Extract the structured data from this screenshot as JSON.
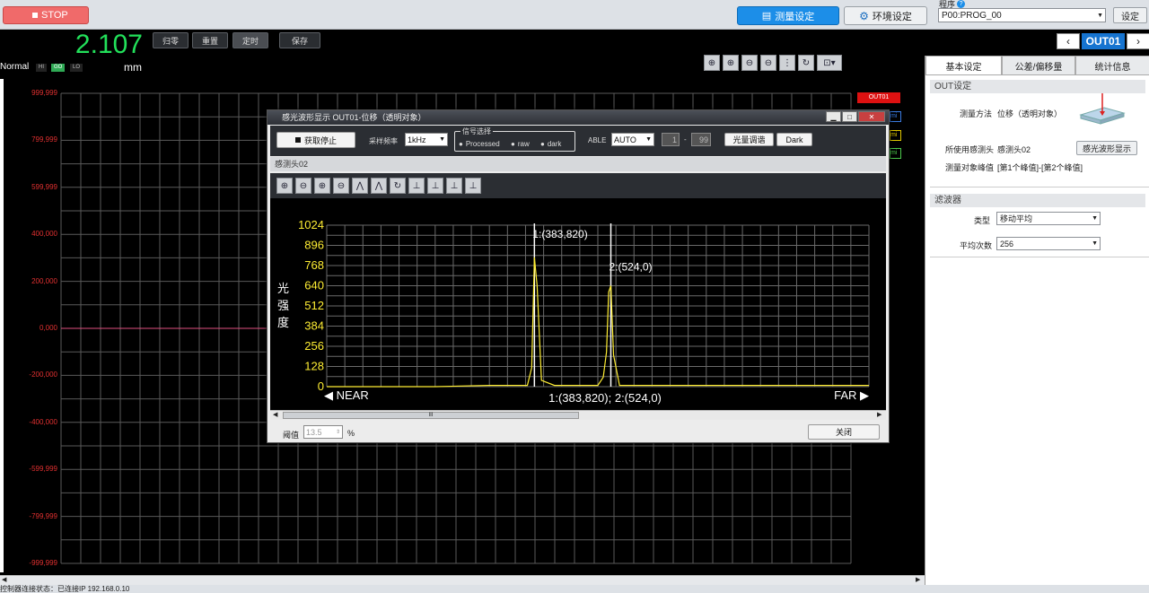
{
  "top": {
    "stop_label": "STOP",
    "measure_setting": "测量设定",
    "env_setting": "环境设定",
    "program_label": "程序",
    "program_value": "P00:PROG_00",
    "set_button": "设定"
  },
  "display": {
    "value": "2.107",
    "status": "Normal",
    "hi": "HI",
    "go": "GO",
    "lo": "LO",
    "unit": "mm",
    "buttons": [
      "归零",
      "重置",
      "定时",
      "保存"
    ]
  },
  "graph": {
    "y_ticks": [
      "999,999",
      "799,999",
      "599,999",
      "400,000",
      "200,000",
      "0,000",
      "-200,000",
      "-400,000",
      "-599,999",
      "-799,999",
      "-999,999"
    ],
    "out_badge": "OUT01"
  },
  "right": {
    "out_nav": "OUT01",
    "tabs": [
      "基本设定",
      "公差/偏移量",
      "统计信息"
    ],
    "out_section": "OUT设定",
    "method_label": "测量方法",
    "method_value": "位移（透明对象）",
    "head_label": "所使用感测头",
    "head_value": "感测头02",
    "wave_button": "感光波形显示",
    "target_label": "测量对象峰值",
    "target_value": "[第1个峰值]-[第2个峰值]",
    "filter_section": "滤波器",
    "type_label": "类型",
    "type_value": "移动平均",
    "avg_label": "平均次数",
    "avg_value": "256"
  },
  "status_bar": "控制器连接状态：已连接IP 192.168.0.10",
  "dialog": {
    "title": "感光波形显示 OUT01-位移（透明对象）",
    "stop_capture": "获取停止",
    "sampling_label": "采样频率",
    "sampling_value": "1kHz",
    "signal_group": "信号选择",
    "radio_processed": "Processed",
    "radio_raw": "raw",
    "radio_dark": "dark",
    "able_label": "ABLE",
    "able_value": "AUTO",
    "range_from": "1",
    "range_sep": "-",
    "range_to": "99",
    "light_adjust": "光量调谐",
    "dark_button": "Dark",
    "head_tab": "感测头02",
    "threshold_label": "阈值",
    "threshold_value": "13.5",
    "threshold_unit": "%",
    "close_button": "关闭",
    "scroll_mark": "III"
  },
  "chart_data": {
    "type": "line",
    "ylabel": "光强度",
    "ylim": [
      0,
      1024
    ],
    "y_ticks": [
      0,
      128,
      256,
      384,
      512,
      640,
      768,
      896,
      1024
    ],
    "near_label": "NEAR",
    "far_label": "FAR",
    "peak1_label": "1:(383,820)",
    "peak2_label": "2:(524,0)",
    "footer_label": "1:(383,820); 2:(524,0)",
    "x": [
      0,
      200,
      300,
      340,
      370,
      378,
      383,
      388,
      396,
      420,
      500,
      510,
      516,
      520,
      524,
      529,
      540,
      600,
      700,
      1000
    ],
    "values": [
      0,
      0,
      8,
      8,
      8,
      120,
      820,
      640,
      40,
      8,
      8,
      60,
      220,
      600,
      640,
      200,
      8,
      8,
      8,
      8
    ]
  },
  "colors": {
    "accent": "#1c8ee8",
    "stop": "#f06a6a",
    "value_green": "#22e05a",
    "axis_yellow": "#ffee33",
    "grid_red_labels": "#e03030"
  }
}
